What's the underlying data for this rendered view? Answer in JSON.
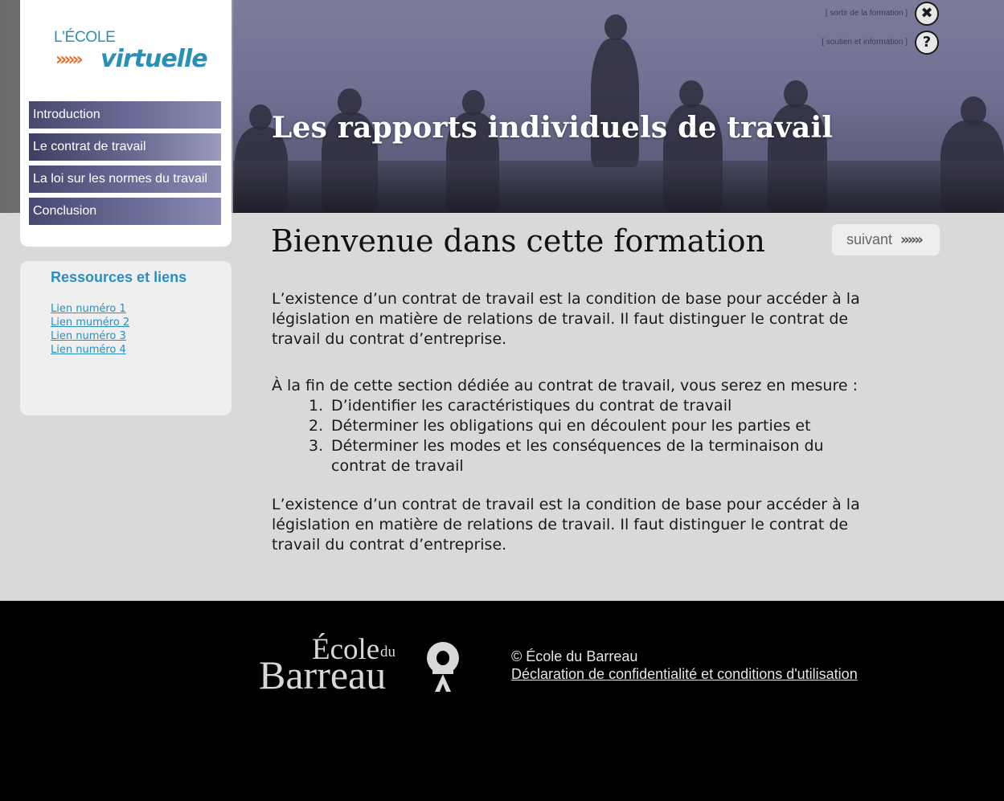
{
  "header": {
    "title": "Les rapports individuels de travail",
    "exit_link": "[ sortir de la formation ]",
    "help_link": "[ soutien et information ]",
    "exit_icon": "close-icon",
    "help_icon": "help-icon",
    "exit_glyph": "✖",
    "help_glyph": "?"
  },
  "logo": {
    "top": "L'ÉCOLE",
    "arrows": "»»»",
    "bottom": "virtuelle"
  },
  "sidebar": {
    "items": [
      {
        "label": "Introduction"
      },
      {
        "label": "Le contrat de travail"
      },
      {
        "label": "La loi sur les normes du travail"
      },
      {
        "label": "Conclusion"
      }
    ]
  },
  "resources": {
    "title": "Ressources et liens",
    "links": [
      "Lien numéro 1",
      "Lien muméro 2",
      "Lien numéro 3",
      "Lien numéro 4"
    ]
  },
  "main": {
    "title": "Bienvenue dans cette formation",
    "next_label": "suivant",
    "next_arrows": "»»»",
    "para1": "L’existence d’un contrat de travail est la condition de base pour accéder à la législation en matière de relations de travail. Il faut distinguer le contrat de travail du contrat d’entreprise.",
    "intro_line": "À la fin de cette section dédiée au contrat de travail, vous serez en mesure :",
    "objectives": [
      {
        "num": "1.",
        "text": "D’identifier les caractéristiques du contrat de travail"
      },
      {
        "num": "2.",
        "text": "Déterminer les obligations qui en découlent pour les parties et"
      },
      {
        "num": "3.",
        "text": "Déterminer les modes et les conséquences de la terminaison du contrat de travail"
      }
    ],
    "para2": "L’existence d’un contrat de travail est la condition de base pour accéder à la législation en matière de relations de travail. Il faut distinguer le contrat de travail du contrat d’entreprise."
  },
  "footer": {
    "logo_ecole": "École",
    "logo_du": "du",
    "logo_barreau": "Barreau",
    "copyright": "© École du Barreau",
    "privacy_link": "Déclaration de confidentialité et conditions d'utilisation"
  },
  "colors": {
    "accent_blue": "#2a8fc0",
    "logo_orange": "#e8702a",
    "nav_purple": "#5a5b85",
    "footer_bg": "#000000",
    "page_bg": "#d9d9d9"
  }
}
